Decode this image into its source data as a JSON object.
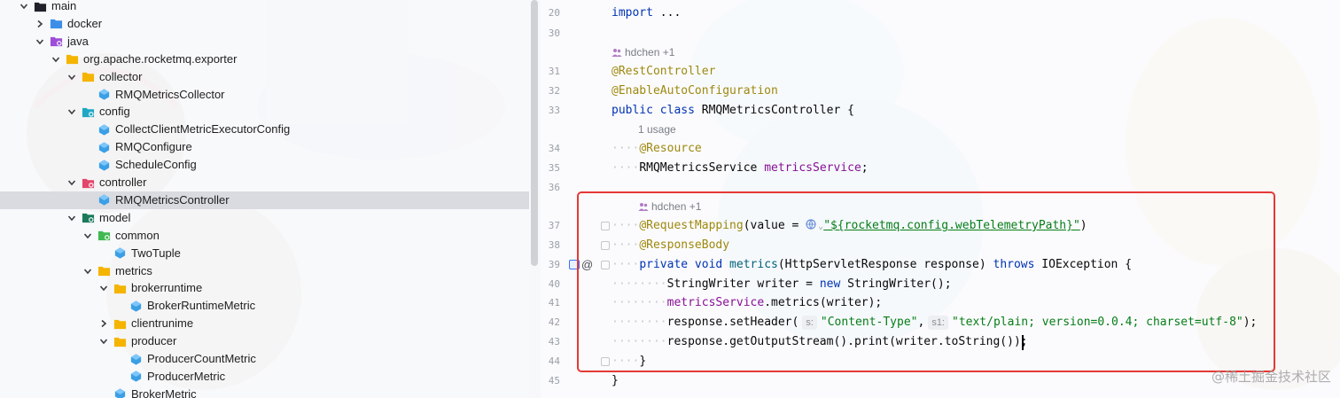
{
  "tree": {
    "items": [
      {
        "label": "main",
        "depth": 0,
        "expanded": true,
        "icon": "folder-icon",
        "color": "#1f2329"
      },
      {
        "label": "docker",
        "depth": 1,
        "expanded": false,
        "icon": "folder-icon",
        "color": "#3d8ee8"
      },
      {
        "label": "java",
        "depth": 1,
        "expanded": true,
        "icon": "source-folder-icon",
        "color": "#9d4ed8"
      },
      {
        "label": "org.apache.rocketmq.exporter",
        "depth": 2,
        "expanded": true,
        "icon": "package-icon",
        "color": "#f4b400"
      },
      {
        "label": "collector",
        "depth": 3,
        "expanded": true,
        "icon": "package-icon",
        "color": "#f4b400"
      },
      {
        "label": "RMQMetricsCollector",
        "depth": 4,
        "icon": "class-icon",
        "color": "#3b9fe6"
      },
      {
        "label": "config",
        "depth": 3,
        "expanded": true,
        "icon": "config-folder-icon",
        "color": "#1fa7c4"
      },
      {
        "label": "CollectClientMetricExecutorConfig",
        "depth": 4,
        "icon": "class-icon",
        "color": "#3b9fe6"
      },
      {
        "label": "RMQConfigure",
        "depth": 4,
        "icon": "class-icon",
        "color": "#3b9fe6"
      },
      {
        "label": "ScheduleConfig",
        "depth": 4,
        "icon": "class-icon",
        "color": "#3b9fe6"
      },
      {
        "label": "controller",
        "depth": 3,
        "expanded": true,
        "icon": "controller-folder-icon",
        "color": "#e3456b"
      },
      {
        "label": "RMQMetricsController",
        "depth": 4,
        "icon": "class-icon",
        "color": "#3b9fe6",
        "selected": true
      },
      {
        "label": "model",
        "depth": 3,
        "expanded": true,
        "icon": "model-folder-icon",
        "color": "#1b7a5a"
      },
      {
        "label": "common",
        "depth": 4,
        "expanded": true,
        "icon": "common-folder-icon",
        "color": "#3fb950"
      },
      {
        "label": "TwoTuple",
        "depth": 5,
        "icon": "class-icon",
        "color": "#3b9fe6"
      },
      {
        "label": "metrics",
        "depth": 4,
        "expanded": true,
        "icon": "package-icon",
        "color": "#f4b400"
      },
      {
        "label": "brokerruntime",
        "depth": 5,
        "expanded": true,
        "icon": "package-icon",
        "color": "#f4b400"
      },
      {
        "label": "BrokerRuntimeMetric",
        "depth": 6,
        "icon": "class-icon",
        "color": "#3b9fe6"
      },
      {
        "label": "clientrunime",
        "depth": 5,
        "expanded": false,
        "icon": "package-icon",
        "color": "#f4b400"
      },
      {
        "label": "producer",
        "depth": 5,
        "expanded": true,
        "icon": "package-icon",
        "color": "#f4b400"
      },
      {
        "label": "ProducerCountMetric",
        "depth": 6,
        "icon": "class-icon",
        "color": "#3b9fe6"
      },
      {
        "label": "ProducerMetric",
        "depth": 6,
        "icon": "class-icon",
        "color": "#3b9fe6"
      },
      {
        "label": "BrokerMetric",
        "depth": 5,
        "icon": "class-icon",
        "color": "#3b9fe6"
      }
    ]
  },
  "editor": {
    "line_numbers": [
      "20",
      "30",
      "31",
      "32",
      "33",
      "34",
      "35",
      "36",
      "37",
      "38",
      "39",
      "40",
      "41",
      "42",
      "43",
      "44",
      "45"
    ],
    "line_39_marker": "@",
    "hints": {
      "author_1": "hdchen +1",
      "usage": "1 usage",
      "author_2": "hdchen +1"
    },
    "code": {
      "l20_kw": "import",
      "l20_rest": " ...",
      "l31": "@RestController",
      "l32": "@EnableAutoConfiguration",
      "l33_kw": "public class",
      "l33_rest": " RMQMetricsController {",
      "l34": "@Resource",
      "l35_type": "RMQMetricsService ",
      "l35_field": "metricsService",
      "l35_end": ";",
      "l37_ann": "@RequestMapping",
      "l37_a": "(value = ",
      "l37_str": "\"${rocketmq.config.webTelemetryPath}\"",
      "l37_b": ")",
      "l38": "@ResponseBody",
      "l39_kw1": "private void",
      "l39_mth": " metrics",
      "l39_a": "(HttpServletResponse response) ",
      "l39_kw2": "throws",
      "l39_b": " IOException {",
      "l40_a": "StringWriter writer = ",
      "l40_kw": "new",
      "l40_b": " StringWriter();",
      "l41_field": "metricsService",
      "l41_rest": ".metrics(writer);",
      "l42_a": "response.setHeader(",
      "l42_hint_s": "s:",
      "l42_str1": "\"Content-Type\"",
      "l42_comma": ",",
      "l42_hint_s1": "s1:",
      "l42_str2": "\"text/plain; version=0.0.4; charset=utf-8\"",
      "l42_end": ");",
      "l43": "response.getOutputStream().print(writer.toString());",
      "l44": "}",
      "l45": "}"
    }
  },
  "watermark": "@稀土掘金技术社区",
  "colors": {
    "highlight_box": "#e53935",
    "keyword": "#0033b3",
    "annotation": "#9e880d",
    "field": "#871094",
    "string": "#067d17"
  }
}
